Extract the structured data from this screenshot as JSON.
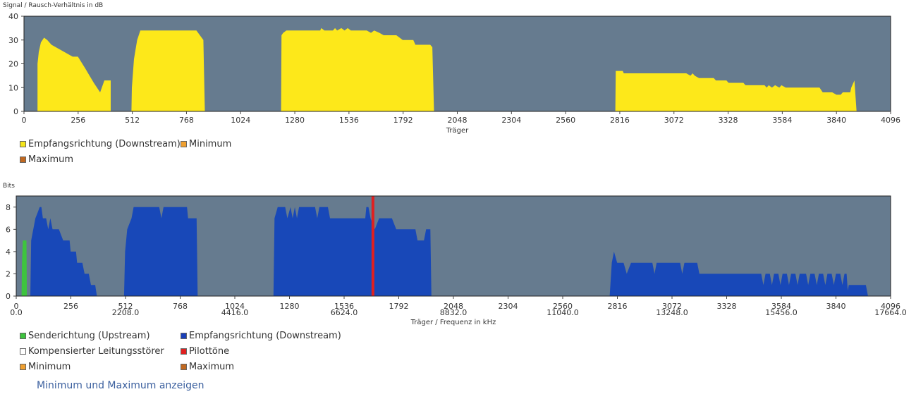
{
  "chart_data": [
    {
      "type": "area",
      "title": "Signal / Rausch-Verhältnis in dB",
      "xlabel": "Träger",
      "ylabel": "",
      "xlim": [
        0,
        4096
      ],
      "ylim": [
        0,
        40
      ],
      "xticks": [
        0,
        256,
        512,
        768,
        1024,
        1280,
        1536,
        1792,
        2048,
        2304,
        2560,
        2816,
        3072,
        3328,
        3584,
        3840,
        4096
      ],
      "yticks": [
        0,
        10,
        20,
        30,
        40
      ],
      "grid": false,
      "background": "#667b8f",
      "legend": [
        {
          "label": "Empfangsrichtung (Downstream)",
          "color": "#f5e51a"
        },
        {
          "label": "Minimum",
          "color": "#f0a030"
        },
        {
          "label": "Maximum",
          "color": "#c06820"
        }
      ],
      "series": [
        {
          "name": "Empfangsrichtung (Downstream)",
          "color": "#fde81a",
          "segments": [
            [
              [
                64,
                0
              ],
              [
                64,
                20
              ],
              [
                70,
                25
              ],
              [
                80,
                29
              ],
              [
                95,
                31
              ],
              [
                110,
                30
              ],
              [
                130,
                28
              ],
              [
                150,
                27
              ],
              [
                170,
                26
              ],
              [
                190,
                25
              ],
              [
                210,
                24
              ],
              [
                230,
                23
              ],
              [
                255,
                23
              ],
              [
                290,
                18
              ],
              [
                330,
                12
              ],
              [
                360,
                8
              ],
              [
                380,
                13
              ],
              [
                410,
                13
              ],
              [
                410,
                0
              ]
            ],
            [
              [
                508,
                0
              ],
              [
                510,
                10
              ],
              [
                520,
                22
              ],
              [
                535,
                30
              ],
              [
                550,
                34
              ],
              [
                815,
                34
              ],
              [
                848,
                30
              ],
              [
                855,
                0
              ]
            ],
            [
              [
                1215,
                0
              ],
              [
                1217,
                32
              ],
              [
                1225,
                33
              ],
              [
                1240,
                34
              ],
              [
                1400,
                34
              ],
              [
                1405,
                35
              ],
              [
                1420,
                34
              ],
              [
                1460,
                34
              ],
              [
                1470,
                35
              ],
              [
                1480,
                34
              ],
              [
                1500,
                35
              ],
              [
                1515,
                34
              ],
              [
                1530,
                35
              ],
              [
                1545,
                34
              ],
              [
                1620,
                34
              ],
              [
                1640,
                33
              ],
              [
                1655,
                34
              ],
              [
                1680,
                33
              ],
              [
                1700,
                32
              ],
              [
                1760,
                32
              ],
              [
                1790,
                30
              ],
              [
                1840,
                30
              ],
              [
                1850,
                28
              ],
              [
                1920,
                28
              ],
              [
                1930,
                27
              ],
              [
                1938,
                0
              ]
            ],
            [
              [
                2795,
                0
              ],
              [
                2797,
                17
              ],
              [
                2830,
                17
              ],
              [
                2835,
                16
              ],
              [
                3130,
                16
              ],
              [
                3150,
                15
              ],
              [
                3160,
                16
              ],
              [
                3170,
                15
              ],
              [
                3190,
                14
              ],
              [
                3260,
                14
              ],
              [
                3270,
                13
              ],
              [
                3320,
                13
              ],
              [
                3330,
                12
              ],
              [
                3400,
                12
              ],
              [
                3410,
                11
              ],
              [
                3500,
                11
              ],
              [
                3510,
                10
              ],
              [
                3520,
                11
              ],
              [
                3535,
                10
              ],
              [
                3550,
                11
              ],
              [
                3570,
                10
              ],
              [
                3580,
                11
              ],
              [
                3600,
                10
              ],
              [
                3760,
                10
              ],
              [
                3775,
                8
              ],
              [
                3820,
                8
              ],
              [
                3840,
                7
              ],
              [
                3860,
                7
              ],
              [
                3870,
                8
              ],
              [
                3905,
                8
              ],
              [
                3910,
                10
              ],
              [
                3920,
                12
              ],
              [
                3925,
                13
              ],
              [
                3935,
                0
              ]
            ]
          ]
        }
      ]
    },
    {
      "type": "area",
      "title": "Bits",
      "xlabel": "Träger / Frequenz in kHz",
      "ylabel": "",
      "xlim": [
        0,
        4096
      ],
      "ylim": [
        0,
        9
      ],
      "xticks": [
        0,
        256,
        512,
        768,
        1024,
        1280,
        1536,
        1792,
        2048,
        2304,
        2560,
        2816,
        3072,
        3328,
        3584,
        3840,
        4096
      ],
      "xticks_secondary": [
        {
          "x": 0,
          "label": "0.0"
        },
        {
          "x": 512,
          "label": "2208.0"
        },
        {
          "x": 1024,
          "label": "4416.0"
        },
        {
          "x": 1536,
          "label": "6624.0"
        },
        {
          "x": 2048,
          "label": "8832.0"
        },
        {
          "x": 2560,
          "label": "11040.0"
        },
        {
          "x": 3072,
          "label": "13248.0"
        },
        {
          "x": 3584,
          "label": "15456.0"
        },
        {
          "x": 4096,
          "label": "17664.0"
        }
      ],
      "yticks": [
        0,
        2,
        4,
        6,
        8
      ],
      "grid": false,
      "background": "#667b8f",
      "legend": [
        {
          "label": "Senderichtung (Upstream)",
          "color": "#3ec43e"
        },
        {
          "label": "Empfangsrichtung (Downstream)",
          "color": "#1a3fb8"
        },
        {
          "label": "Kompensierter Leitungsstörer",
          "color": "#ffffff"
        },
        {
          "label": "Pilottöne",
          "color": "#e02020"
        },
        {
          "label": "Minimum",
          "color": "#f0a030"
        },
        {
          "label": "Maximum",
          "color": "#c06820"
        }
      ],
      "series": [
        {
          "name": "Senderichtung (Upstream)",
          "color": "#3ec43e",
          "segments": [
            [
              [
                25,
                0
              ],
              [
                27,
                3
              ],
              [
                31,
                5
              ],
              [
                48,
                5
              ],
              [
                50,
                0
              ]
            ]
          ]
        },
        {
          "name": "Empfangsrichtung (Downstream)",
          "color": "#1848b8",
          "segments": [
            [
              [
                66,
                0
              ],
              [
                70,
                5
              ],
              [
                80,
                6
              ],
              [
                90,
                7
              ],
              [
                100,
                7.5
              ],
              [
                110,
                8
              ],
              [
                118,
                8
              ],
              [
                125,
                7
              ],
              [
                140,
                7
              ],
              [
                150,
                6
              ],
              [
                160,
                7
              ],
              [
                170,
                6
              ],
              [
                200,
                6
              ],
              [
                220,
                5
              ],
              [
                250,
                5
              ],
              [
                255,
                4
              ],
              [
                280,
                4
              ],
              [
                285,
                3
              ],
              [
                310,
                3
              ],
              [
                320,
                2
              ],
              [
                340,
                2
              ],
              [
                350,
                1
              ],
              [
                370,
                1
              ],
              [
                378,
                0
              ]
            ],
            [
              [
                505,
                0
              ],
              [
                510,
                4
              ],
              [
                520,
                6
              ],
              [
                540,
                7
              ],
              [
                550,
                8
              ],
              [
                670,
                8
              ],
              [
                680,
                7
              ],
              [
                690,
                8
              ],
              [
                800,
                8
              ],
              [
                805,
                7
              ],
              [
                845,
                7
              ],
              [
                850,
                0
              ]
            ],
            [
              [
                1205,
                0
              ],
              [
                1210,
                7
              ],
              [
                1225,
                8
              ],
              [
                1260,
                8
              ],
              [
                1270,
                7
              ],
              [
                1285,
                8
              ],
              [
                1295,
                7
              ],
              [
                1305,
                8
              ],
              [
                1315,
                7
              ],
              [
                1325,
                8
              ],
              [
                1400,
                8
              ],
              [
                1410,
                7
              ],
              [
                1420,
                8
              ],
              [
                1460,
                8
              ],
              [
                1470,
                7
              ],
              [
                1495,
                7
              ],
              [
                1635,
                7
              ],
              [
                1640,
                8
              ],
              [
                1650,
                8
              ],
              [
                1660,
                7
              ],
              [
                1680,
                6
              ],
              [
                1700,
                7
              ],
              [
                1760,
                7
              ],
              [
                1780,
                6
              ],
              [
                1870,
                6
              ],
              [
                1880,
                5
              ],
              [
                1910,
                5
              ],
              [
                1920,
                6
              ],
              [
                1940,
                6
              ],
              [
                1945,
                0
              ]
            ],
            [
              [
                2780,
                0
              ],
              [
                2790,
                3
              ],
              [
                2800,
                4
              ],
              [
                2815,
                3
              ],
              [
                2845,
                3
              ],
              [
                2860,
                2
              ],
              [
                2880,
                3
              ],
              [
                2980,
                3
              ],
              [
                2990,
                2
              ],
              [
                3000,
                3
              ],
              [
                3110,
                3
              ],
              [
                3120,
                2
              ],
              [
                3130,
                3
              ],
              [
                3190,
                3
              ],
              [
                3200,
                2
              ],
              [
                3490,
                2
              ],
              [
                3500,
                1
              ],
              [
                3510,
                2
              ],
              [
                3530,
                2
              ],
              [
                3540,
                1
              ],
              [
                3550,
                2
              ],
              [
                3570,
                2
              ],
              [
                3580,
                1
              ],
              [
                3590,
                2
              ],
              [
                3610,
                2
              ],
              [
                3620,
                1
              ],
              [
                3630,
                2
              ],
              [
                3650,
                2
              ],
              [
                3660,
                1
              ],
              [
                3670,
                2
              ],
              [
                3700,
                2
              ],
              [
                3710,
                1
              ],
              [
                3720,
                2
              ],
              [
                3740,
                2
              ],
              [
                3750,
                1
              ],
              [
                3760,
                2
              ],
              [
                3780,
                2
              ],
              [
                3790,
                1
              ],
              [
                3800,
                2
              ],
              [
                3820,
                2
              ],
              [
                3830,
                1
              ],
              [
                3840,
                2
              ],
              [
                3860,
                2
              ],
              [
                3870,
                1
              ],
              [
                3880,
                2
              ],
              [
                3890,
                2
              ],
              [
                3895,
                0.5
              ],
              [
                3900,
                1
              ],
              [
                3980,
                1
              ],
              [
                3990,
                0
              ]
            ]
          ]
        },
        {
          "name": "Pilottöne",
          "color": "#e02020",
          "type": "vline",
          "x": 1671
        }
      ]
    }
  ],
  "legend_top": {
    "downstream": "Empfangsrichtung (Downstream)",
    "minimum": "Minimum",
    "maximum": "Maximum"
  },
  "legend_bottom": {
    "upstream": "Senderichtung (Upstream)",
    "downstream": "Empfangsrichtung (Downstream)",
    "compensated": "Kompensierter Leitungsstörer",
    "pilot": "Pilottöne",
    "minimum": "Minimum",
    "maximum": "Maximum"
  },
  "toggle_link": "Minimum und Maximum anzeigen"
}
